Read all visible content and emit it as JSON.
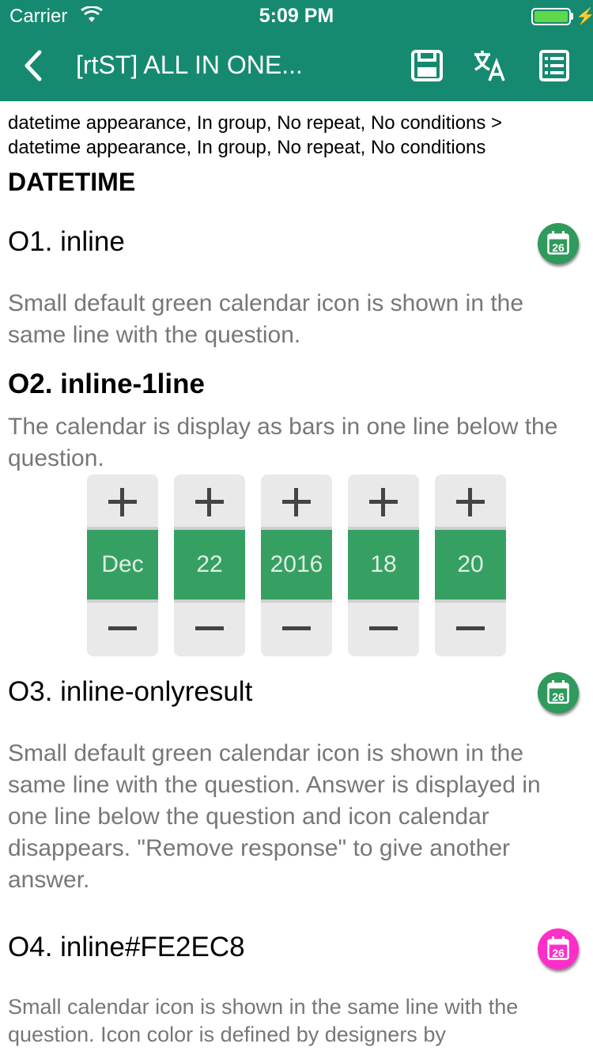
{
  "status_bar": {
    "carrier": "Carrier",
    "time": "5:09 PM"
  },
  "nav": {
    "title": "[rtST] ALL IN ONE...",
    "back_icon": "chevron-left-icon",
    "save_icon": "save-icon",
    "translate_icon": "translate-icon",
    "list_icon": "list-icon"
  },
  "content": {
    "breadcrumb_line1": "datetime appearance, In group, No repeat, No conditions >",
    "breadcrumb_line2": "datetime appearance, In group, No repeat, No conditions",
    "group_title": "DATETIME"
  },
  "calendar_icon_day": "26",
  "questions": [
    {
      "label": "O1. inline",
      "hint": "Small default green calendar icon is shown in the same line with the question.",
      "icon_color": "#2e9a5c"
    },
    {
      "label": "O2. inline-1line",
      "hint": "The calendar is display as bars in one line below the question."
    },
    {
      "label": "O3. inline-onlyresult",
      "hint": "Small default green calendar icon is shown in the same line with the question. Answer is displayed in one line below the question and icon calendar disappears. \"Remove response\" to give another answer.",
      "icon_color": "#2e9a5c"
    },
    {
      "label": "O4. inline#FE2EC8",
      "hint": "Small calendar icon is shown in the same line with the question. Icon color is defined by designers by",
      "icon_color": "#fe2ec8"
    }
  ],
  "spinners": [
    {
      "value": "Dec"
    },
    {
      "value": "22"
    },
    {
      "value": "2016"
    },
    {
      "value": "18"
    },
    {
      "value": "20"
    }
  ]
}
